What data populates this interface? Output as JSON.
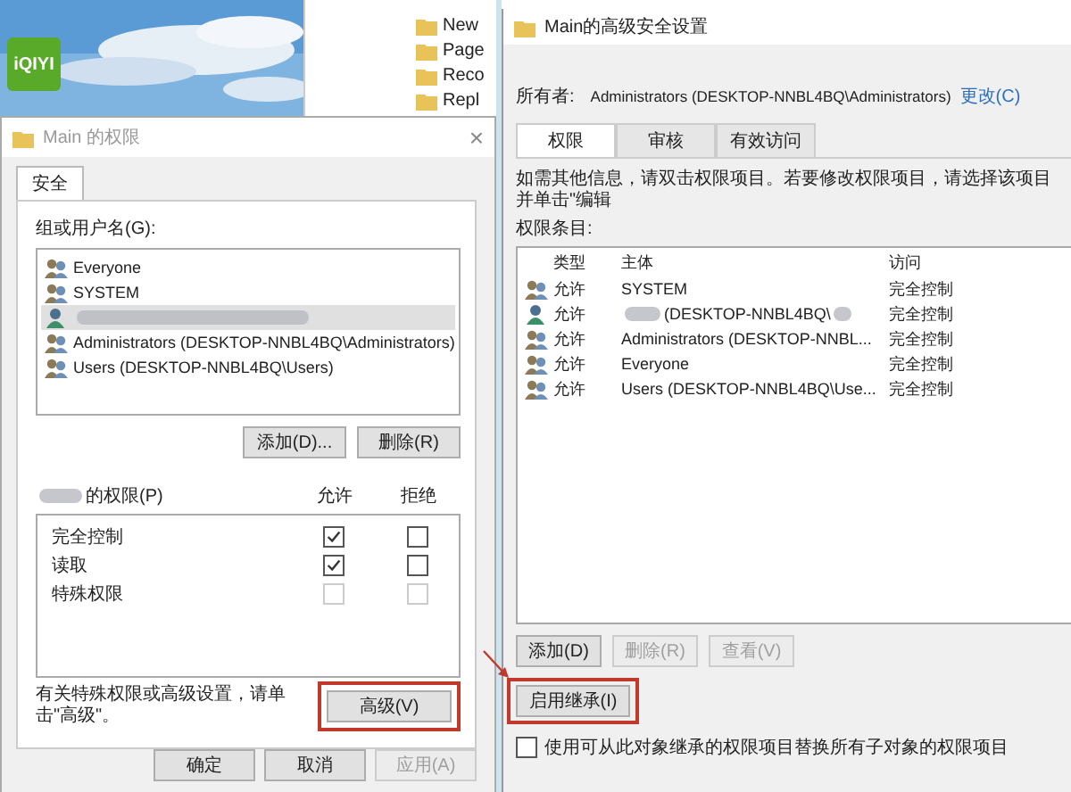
{
  "desktop": {
    "app_icon": {
      "label": "iQIYI"
    }
  },
  "explorer_tree": {
    "items": [
      "New",
      "Page",
      "Reco",
      "Repl"
    ]
  },
  "permissions_dialog": {
    "title": "Main 的权限",
    "close": "×",
    "tabs": [
      {
        "label": "安全",
        "selected": true
      }
    ],
    "group_label": "组或用户名(G):",
    "principals": [
      {
        "kind": "group",
        "name": "Everyone",
        "selected": false
      },
      {
        "kind": "group",
        "name": "SYSTEM",
        "selected": false
      },
      {
        "kind": "redacted",
        "selected": true
      },
      {
        "kind": "group",
        "name": "Administrators (DESKTOP-NNBL4BQ\\Administrators)",
        "selected": false
      },
      {
        "kind": "group",
        "name": "Users (DESKTOP-NNBL4BQ\\Users)",
        "selected": false
      }
    ],
    "list_buttons": [
      "添加(D)...",
      "删除(R)"
    ],
    "permissions_label": "的权限(P)",
    "columns": [
      "允许",
      "拒绝"
    ],
    "permissions": [
      {
        "name": "完全控制",
        "allow": {
          "checked": true,
          "disabled": false
        },
        "deny": {
          "checked": false,
          "disabled": false
        }
      },
      {
        "name": "读取",
        "allow": {
          "checked": true,
          "disabled": false
        },
        "deny": {
          "checked": false,
          "disabled": false
        }
      },
      {
        "name": "特殊权限",
        "allow": {
          "checked": false,
          "disabled": true
        },
        "deny": {
          "checked": false,
          "disabled": true
        }
      }
    ],
    "hint": "有关特殊权限或高级设置，请单击\"高级\"。",
    "advanced_button": {
      "label": "高级(V)",
      "highlighted": true
    },
    "footer_buttons": [
      {
        "label": "确定",
        "disabled": false
      },
      {
        "label": "取消",
        "disabled": false
      },
      {
        "label": "应用(A)",
        "disabled": true
      }
    ]
  },
  "advanced_dialog": {
    "title": "Main的高级安全设置",
    "owner_label": "所有者:",
    "owner": "Administrators (DESKTOP-NNBL4BQ\\Administrators)",
    "change_link": "更改(C)",
    "tabs": [
      {
        "label": "权限",
        "selected": true
      },
      {
        "label": "审核",
        "selected": false
      },
      {
        "label": "有效访问",
        "selected": false
      }
    ],
    "info": "如需其他信息，请双击权限项目。若要修改权限项目，请选择该项目并单击\"编辑",
    "entries_label": "权限条目:",
    "columns": [
      "类型",
      "主体",
      "访问"
    ],
    "entries": [
      {
        "kind": "group",
        "type": "允许",
        "principal": "SYSTEM",
        "access": "完全控制"
      },
      {
        "kind": "user",
        "type": "允许",
        "principal": "(DESKTOP-NNBL4BQ\\",
        "access": "完全控制"
      },
      {
        "kind": "group",
        "type": "允许",
        "principal": "Administrators (DESKTOP-NNBL...",
        "access": "完全控制"
      },
      {
        "kind": "group",
        "type": "允许",
        "principal": "Everyone",
        "access": "完全控制"
      },
      {
        "kind": "group",
        "type": "允许",
        "principal": "Users (DESKTOP-NNBL4BQ\\Use...",
        "access": "完全控制"
      }
    ],
    "entry_buttons": [
      {
        "label": "添加(D)",
        "disabled": false
      },
      {
        "label": "删除(R)",
        "disabled": true
      },
      {
        "label": "查看(V)",
        "disabled": true
      }
    ],
    "inherit_button": {
      "label": "启用继承(I)",
      "highlighted": true
    },
    "replace_option": {
      "label": "使用可从此对象继承的权限项目替换所有子对象的权限项目",
      "checked": false
    }
  }
}
